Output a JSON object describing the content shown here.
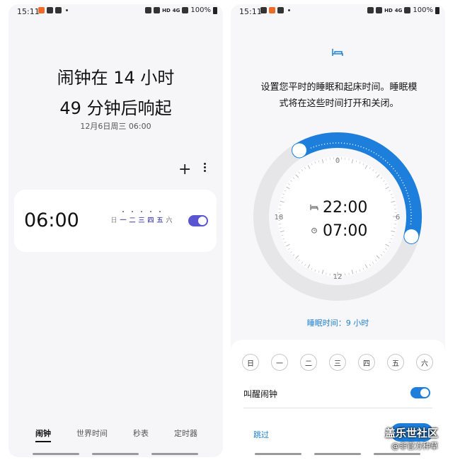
{
  "left": {
    "status": {
      "time": "15:11",
      "net": "HD",
      "signal": "4G",
      "battery": "100%"
    },
    "title_line1": "闹钟在 14 小时",
    "title_line2": "49 分钟后响起",
    "subtitle": "12月6日周三 06:00",
    "add_label": "+",
    "alarm": {
      "time": "06:00",
      "enabled": true,
      "days": [
        {
          "label": "日",
          "active": false
        },
        {
          "label": "一",
          "active": true
        },
        {
          "label": "二",
          "active": true
        },
        {
          "label": "三",
          "active": true
        },
        {
          "label": "四",
          "active": true
        },
        {
          "label": "五",
          "active": true
        },
        {
          "label": "六",
          "active": false
        }
      ]
    },
    "tabs": [
      "闹钟",
      "世界时间",
      "秒表",
      "定时器"
    ],
    "active_tab": "闹钟"
  },
  "right": {
    "status": {
      "time": "15:11",
      "net": "HD",
      "signal": "4G",
      "battery": "100%"
    },
    "description_line1": "设置您平时的睡眠和起床时间。睡眠模",
    "description_line2": "式将在这些时间打开和关闭。",
    "dial": {
      "labels": [
        "0",
        "6",
        "12",
        "18"
      ],
      "bedtime": "22:00",
      "wake_time": "07:00",
      "accent": "#1d7fdb"
    },
    "sleep_duration": "睡眠时间：9 小时",
    "weekdays": [
      "日",
      "一",
      "二",
      "三",
      "四",
      "五",
      "六"
    ],
    "wake_alarm_label": "叫醒闹钟",
    "wake_alarm_enabled": true,
    "skip_label": "跳过"
  },
  "watermark": {
    "brand": "盖乐世社区",
    "sub": "@非官方种草"
  },
  "colors": {
    "toggle_left": "#5a55d1",
    "accent_blue": "#1d7fdb"
  }
}
